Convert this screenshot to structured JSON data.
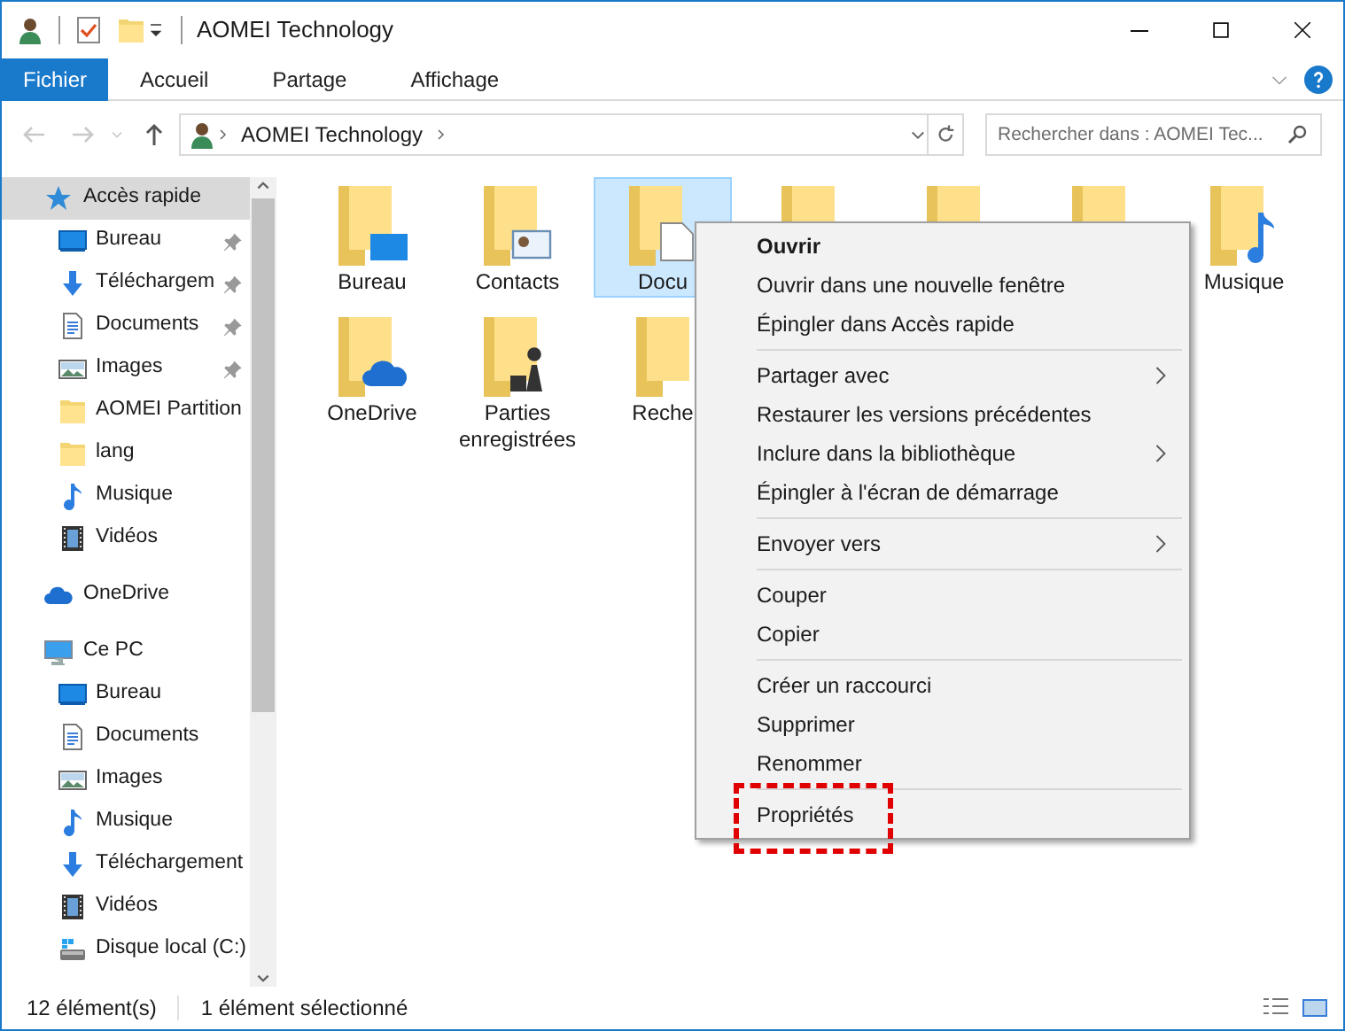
{
  "window": {
    "title": "AOMEI Technology"
  },
  "ribbon": {
    "tabs": [
      {
        "label": "Fichier",
        "selected": true
      },
      {
        "label": "Accueil",
        "selected": false
      },
      {
        "label": "Partage",
        "selected": false
      },
      {
        "label": "Affichage",
        "selected": false
      }
    ]
  },
  "address_bar": {
    "path": [
      "AOMEI Technology"
    ],
    "search": {
      "placeholder": "Rechercher dans : AOMEI Tec..."
    }
  },
  "sidebar": {
    "sections": [
      {
        "label": "Accès rapide",
        "selected": true,
        "children": [
          {
            "label": "Bureau",
            "pinned": true
          },
          {
            "label": "Téléchargem",
            "pinned": true
          },
          {
            "label": "Documents",
            "pinned": true
          },
          {
            "label": "Images",
            "pinned": true
          },
          {
            "label": "AOMEI Partition",
            "pinned": false
          },
          {
            "label": "lang",
            "pinned": false
          },
          {
            "label": "Musique",
            "pinned": false
          },
          {
            "label": "Vidéos",
            "pinned": false
          }
        ]
      },
      {
        "label": "OneDrive",
        "selected": false
      },
      {
        "label": "Ce PC",
        "selected": false,
        "children": [
          {
            "label": "Bureau",
            "pinned": false
          },
          {
            "label": "Documents",
            "pinned": false
          },
          {
            "label": "Images",
            "pinned": false
          },
          {
            "label": "Musique",
            "pinned": false
          },
          {
            "label": "Téléchargement",
            "pinned": false
          },
          {
            "label": "Vidéos",
            "pinned": false
          },
          {
            "label": "Disque local (C:)",
            "pinned": false
          }
        ]
      }
    ]
  },
  "items": [
    {
      "label": "Bureau",
      "selected": false
    },
    {
      "label": "Contacts",
      "selected": false
    },
    {
      "label": "Docu",
      "selected": true
    },
    {
      "selected": false
    },
    {
      "selected": false
    },
    {
      "selected": false
    },
    {
      "label": "Musique",
      "selected": false
    },
    {
      "label": "OneDrive",
      "selected": false
    },
    {
      "label": "Parties enregistrées",
      "selected": false
    },
    {
      "label": "Reche",
      "selected": false
    }
  ],
  "context_menu": {
    "groups": [
      {
        "items": [
          {
            "label": "Ouvrir",
            "default": true,
            "submenu": false,
            "highlighted": false
          },
          {
            "label": "Ouvrir dans une nouvelle fenêtre",
            "default": false,
            "submenu": false,
            "highlighted": false
          },
          {
            "label": "Épingler dans Accès rapide",
            "default": false,
            "submenu": false,
            "highlighted": false
          }
        ]
      },
      {
        "items": [
          {
            "label": "Partager avec",
            "default": false,
            "submenu": true,
            "highlighted": false
          },
          {
            "label": "Restaurer les versions précédentes",
            "default": false,
            "submenu": false,
            "highlighted": false
          },
          {
            "label": "Inclure dans la bibliothèque",
            "default": false,
            "submenu": true,
            "highlighted": false
          },
          {
            "label": "Épingler à l'écran de démarrage",
            "default": false,
            "submenu": false,
            "highlighted": false
          }
        ]
      },
      {
        "items": [
          {
            "label": "Envoyer vers",
            "default": false,
            "submenu": true,
            "highlighted": false
          }
        ]
      },
      {
        "items": [
          {
            "label": "Couper",
            "default": false,
            "submenu": false,
            "highlighted": false
          },
          {
            "label": "Copier",
            "default": false,
            "submenu": false,
            "highlighted": false
          }
        ]
      },
      {
        "items": [
          {
            "label": "Créer un raccourci",
            "default": false,
            "submenu": false,
            "highlighted": false
          },
          {
            "label": "Supprimer",
            "default": false,
            "submenu": false,
            "highlighted": false
          },
          {
            "label": "Renommer",
            "default": false,
            "submenu": false,
            "highlighted": false
          }
        ]
      },
      {
        "items": [
          {
            "label": "Propriétés",
            "default": false,
            "submenu": false,
            "highlighted": true
          }
        ]
      }
    ]
  },
  "status_bar": {
    "item_count": "12 élément(s)",
    "selection": "1 élément sélectionné"
  }
}
